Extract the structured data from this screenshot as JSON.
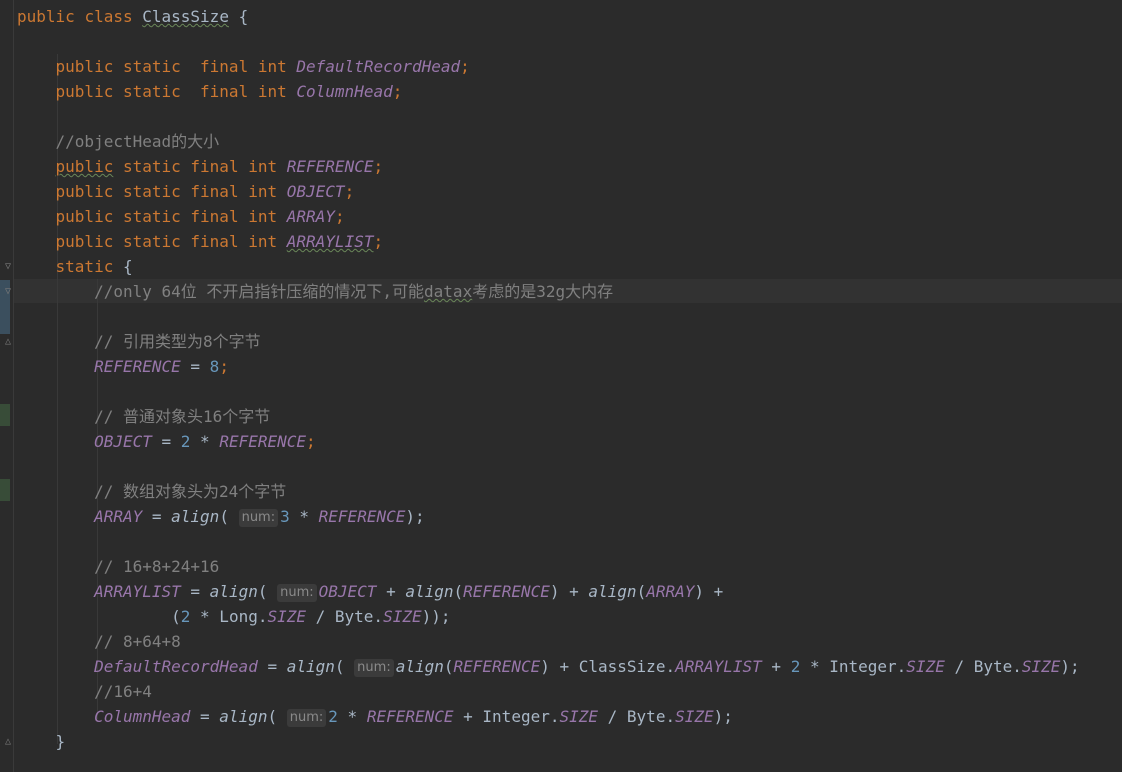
{
  "editor": {
    "lines": [
      [
        {
          "t": "public",
          "c": "kw"
        },
        {
          "t": " "
        },
        {
          "t": "class",
          "c": "kw"
        },
        {
          "t": " "
        },
        {
          "t": "ClassSize",
          "c": "cls squiggle"
        },
        {
          "t": " {"
        }
      ],
      [],
      [
        {
          "t": "    "
        },
        {
          "t": "public",
          "c": "kw"
        },
        {
          "t": " "
        },
        {
          "t": "static",
          "c": "kw"
        },
        {
          "t": "  "
        },
        {
          "t": "final",
          "c": "kw"
        },
        {
          "t": " "
        },
        {
          "t": "int",
          "c": "kw"
        },
        {
          "t": " "
        },
        {
          "t": "DefaultRecordHead",
          "c": "field"
        },
        {
          "t": ";",
          "c": "punct"
        }
      ],
      [
        {
          "t": "    "
        },
        {
          "t": "public",
          "c": "kw"
        },
        {
          "t": " "
        },
        {
          "t": "static",
          "c": "kw"
        },
        {
          "t": "  "
        },
        {
          "t": "final",
          "c": "kw"
        },
        {
          "t": " "
        },
        {
          "t": "int",
          "c": "kw"
        },
        {
          "t": " "
        },
        {
          "t": "ColumnHead",
          "c": "field"
        },
        {
          "t": ";",
          "c": "punct"
        }
      ],
      [],
      [
        {
          "t": "    "
        },
        {
          "t": "//objectHead的大小",
          "c": "comment"
        }
      ],
      [
        {
          "t": "    "
        },
        {
          "t": "public",
          "c": "kw squiggle"
        },
        {
          "t": " "
        },
        {
          "t": "static",
          "c": "kw"
        },
        {
          "t": " "
        },
        {
          "t": "final",
          "c": "kw"
        },
        {
          "t": " "
        },
        {
          "t": "int",
          "c": "kw"
        },
        {
          "t": " "
        },
        {
          "t": "REFERENCE",
          "c": "field"
        },
        {
          "t": ";",
          "c": "punct"
        }
      ],
      [
        {
          "t": "    "
        },
        {
          "t": "public",
          "c": "kw"
        },
        {
          "t": " "
        },
        {
          "t": "static",
          "c": "kw"
        },
        {
          "t": " "
        },
        {
          "t": "final",
          "c": "kw"
        },
        {
          "t": " "
        },
        {
          "t": "int",
          "c": "kw"
        },
        {
          "t": " "
        },
        {
          "t": "OBJECT",
          "c": "field"
        },
        {
          "t": ";",
          "c": "punct"
        }
      ],
      [
        {
          "t": "    "
        },
        {
          "t": "public",
          "c": "kw"
        },
        {
          "t": " "
        },
        {
          "t": "static",
          "c": "kw"
        },
        {
          "t": " "
        },
        {
          "t": "final",
          "c": "kw"
        },
        {
          "t": " "
        },
        {
          "t": "int",
          "c": "kw"
        },
        {
          "t": " "
        },
        {
          "t": "ARRAY",
          "c": "field"
        },
        {
          "t": ";",
          "c": "punct"
        }
      ],
      [
        {
          "t": "    "
        },
        {
          "t": "public",
          "c": "kw"
        },
        {
          "t": " "
        },
        {
          "t": "static",
          "c": "kw"
        },
        {
          "t": " "
        },
        {
          "t": "final",
          "c": "kw"
        },
        {
          "t": " "
        },
        {
          "t": "int",
          "c": "kw"
        },
        {
          "t": " "
        },
        {
          "t": "ARRAYLIST",
          "c": "field squiggle"
        },
        {
          "t": ";",
          "c": "punct"
        }
      ],
      [
        {
          "t": "    "
        },
        {
          "t": "static",
          "c": "kw"
        },
        {
          "t": " {"
        }
      ],
      [
        {
          "t": "        "
        },
        {
          "t": "//only 64位 不开启指针压缩的情况下,可能",
          "c": "comment"
        },
        {
          "t": "datax",
          "c": "comment squiggle"
        },
        {
          "t": "考虑的是32g大内存",
          "c": "comment"
        }
      ],
      [],
      [
        {
          "t": "        "
        },
        {
          "t": "// 引用类型为8个字节",
          "c": "comment"
        }
      ],
      [
        {
          "t": "        "
        },
        {
          "t": "REFERENCE",
          "c": "field"
        },
        {
          "t": " = "
        },
        {
          "t": "8",
          "c": "num"
        },
        {
          "t": ";",
          "c": "punct"
        }
      ],
      [],
      [
        {
          "t": "        "
        },
        {
          "t": "// 普通对象头16个字节",
          "c": "comment"
        }
      ],
      [
        {
          "t": "        "
        },
        {
          "t": "OBJECT",
          "c": "field"
        },
        {
          "t": " = "
        },
        {
          "t": "2",
          "c": "num"
        },
        {
          "t": " * "
        },
        {
          "t": "REFERENCE",
          "c": "field"
        },
        {
          "t": ";",
          "c": "punct"
        }
      ],
      [],
      [
        {
          "t": "        "
        },
        {
          "t": "// 数组对象头为24个字节",
          "c": "comment"
        }
      ],
      [
        {
          "t": "        "
        },
        {
          "t": "ARRAY",
          "c": "field"
        },
        {
          "t": " = "
        },
        {
          "t": "align",
          "c": "method"
        },
        {
          "t": "( "
        },
        {
          "t": "num:",
          "c": "hint"
        },
        {
          "t": "3",
          "c": "num"
        },
        {
          "t": " * "
        },
        {
          "t": "REFERENCE",
          "c": "field"
        },
        {
          "t": ");"
        }
      ],
      [],
      [
        {
          "t": "        "
        },
        {
          "t": "// 16+8+24+16",
          "c": "comment"
        }
      ],
      [
        {
          "t": "        "
        },
        {
          "t": "ARRAYLIST",
          "c": "field"
        },
        {
          "t": " = "
        },
        {
          "t": "align",
          "c": "method"
        },
        {
          "t": "( "
        },
        {
          "t": "num:",
          "c": "hint"
        },
        {
          "t": "OBJECT",
          "c": "field"
        },
        {
          "t": " + "
        },
        {
          "t": "align",
          "c": "method"
        },
        {
          "t": "("
        },
        {
          "t": "REFERENCE",
          "c": "field"
        },
        {
          "t": ") + "
        },
        {
          "t": "align",
          "c": "method"
        },
        {
          "t": "("
        },
        {
          "t": "ARRAY",
          "c": "field"
        },
        {
          "t": ") +"
        }
      ],
      [
        {
          "t": "                "
        },
        {
          "t": "("
        },
        {
          "t": "2",
          "c": "num"
        },
        {
          "t": " * Long."
        },
        {
          "t": "SIZE",
          "c": "field"
        },
        {
          "t": " / Byte."
        },
        {
          "t": "SIZE",
          "c": "field"
        },
        {
          "t": "));"
        }
      ],
      [
        {
          "t": "        "
        },
        {
          "t": "// 8+64+8",
          "c": "comment"
        }
      ],
      [
        {
          "t": "        "
        },
        {
          "t": "DefaultRecordHead",
          "c": "field"
        },
        {
          "t": " = "
        },
        {
          "t": "align",
          "c": "method"
        },
        {
          "t": "( "
        },
        {
          "t": "num:",
          "c": "hint"
        },
        {
          "t": "align",
          "c": "method"
        },
        {
          "t": "("
        },
        {
          "t": "REFERENCE",
          "c": "field"
        },
        {
          "t": ") + ClassSize."
        },
        {
          "t": "ARRAYLIST",
          "c": "field"
        },
        {
          "t": " + "
        },
        {
          "t": "2",
          "c": "num"
        },
        {
          "t": " * Integer."
        },
        {
          "t": "SIZE",
          "c": "field"
        },
        {
          "t": " / Byte."
        },
        {
          "t": "SIZE",
          "c": "field"
        },
        {
          "t": ");"
        }
      ],
      [
        {
          "t": "        "
        },
        {
          "t": "//16+4",
          "c": "comment"
        }
      ],
      [
        {
          "t": "        "
        },
        {
          "t": "ColumnHead",
          "c": "field"
        },
        {
          "t": " = "
        },
        {
          "t": "align",
          "c": "method"
        },
        {
          "t": "( "
        },
        {
          "t": "num:",
          "c": "hint"
        },
        {
          "t": "2",
          "c": "num"
        },
        {
          "t": " * "
        },
        {
          "t": "REFERENCE",
          "c": "field"
        },
        {
          "t": " + Integer."
        },
        {
          "t": "SIZE",
          "c": "field"
        },
        {
          "t": " / Byte."
        },
        {
          "t": "SIZE",
          "c": "field"
        },
        {
          "t": ");"
        }
      ],
      [
        {
          "t": "    }"
        }
      ]
    ]
  }
}
